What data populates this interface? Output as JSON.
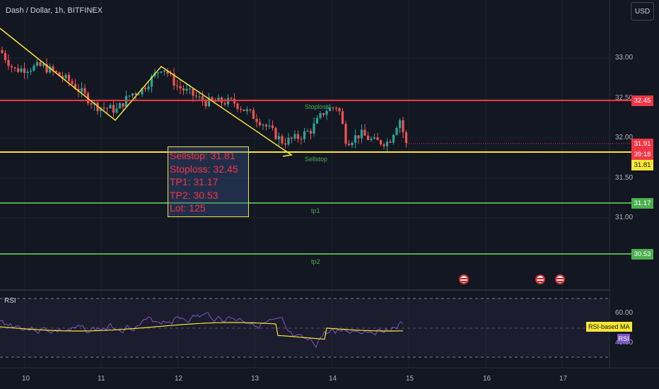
{
  "header": {
    "symbol": "Dash / Dollar, 1h, BITFINEX",
    "currency_button": "USD"
  },
  "price_axis": {
    "labels": [
      "33.00",
      "32.50",
      "32.00",
      "31.50",
      "31.00"
    ]
  },
  "time_axis": {
    "labels": [
      "10",
      "11",
      "12",
      "13",
      "14",
      "15",
      "16",
      "17"
    ]
  },
  "levels": {
    "stoploss": {
      "value": "32.45",
      "color": "#f23645"
    },
    "last_price": {
      "value": "31.91",
      "countdown": "39:18",
      "color": "#f23645"
    },
    "sellstop": {
      "value": "31.81",
      "color": "#f7e534"
    },
    "tp1": {
      "value": "31.17",
      "color": "#4caf50"
    },
    "tp2": {
      "value": "30.53",
      "color": "#4caf50"
    }
  },
  "annotations": {
    "stoploss": "Stoploss",
    "sellstop": "Sellstop",
    "tp1": "tp1",
    "tp2": "tp2"
  },
  "trade_box": {
    "lines": [
      "Sellstop: 31.81",
      "Stoploss: 32.45",
      "TP1: 31.17",
      "TP2: 30.53",
      "Lot: 125"
    ]
  },
  "rsi_pane": {
    "title": "RSI",
    "axis_labels": [
      "60.00",
      "40.00"
    ],
    "ma_label": "RSI-based MA",
    "rsi_label": "RSI"
  },
  "events": [
    "us-flag-icon",
    "us-flag-icon",
    "us-flag-icon"
  ],
  "colors": {
    "background": "#131722",
    "up": "#26a69a",
    "down": "#ef5350",
    "zigzag": "#f7e534",
    "rsi": "#7e57c2",
    "rsi_ma": "#f7e534"
  }
}
